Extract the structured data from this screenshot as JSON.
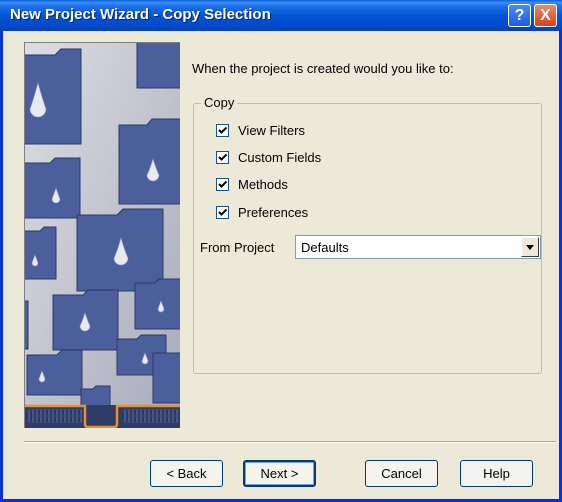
{
  "window": {
    "title": "New Project Wizard - Copy Selection"
  },
  "titlebar_buttons": {
    "help": "?",
    "close": "X"
  },
  "intro_text": "When the project is created would you like to:",
  "copy_group": {
    "legend": "Copy",
    "options": [
      {
        "label": "View Filters",
        "checked": true
      },
      {
        "label": "Custom Fields",
        "checked": true
      },
      {
        "label": "Methods",
        "checked": true
      },
      {
        "label": "Preferences",
        "checked": true
      }
    ]
  },
  "from_project": {
    "label": "From Project",
    "value": "Defaults"
  },
  "buttons": {
    "back": "< Back",
    "next": "Next >",
    "cancel": "Cancel",
    "help": "Help"
  },
  "colors": {
    "titlebar": "#0455d5",
    "dialog_bg": "#ece9d8",
    "folder": "#4a5f9c",
    "accent_orange": "#e8902a"
  }
}
